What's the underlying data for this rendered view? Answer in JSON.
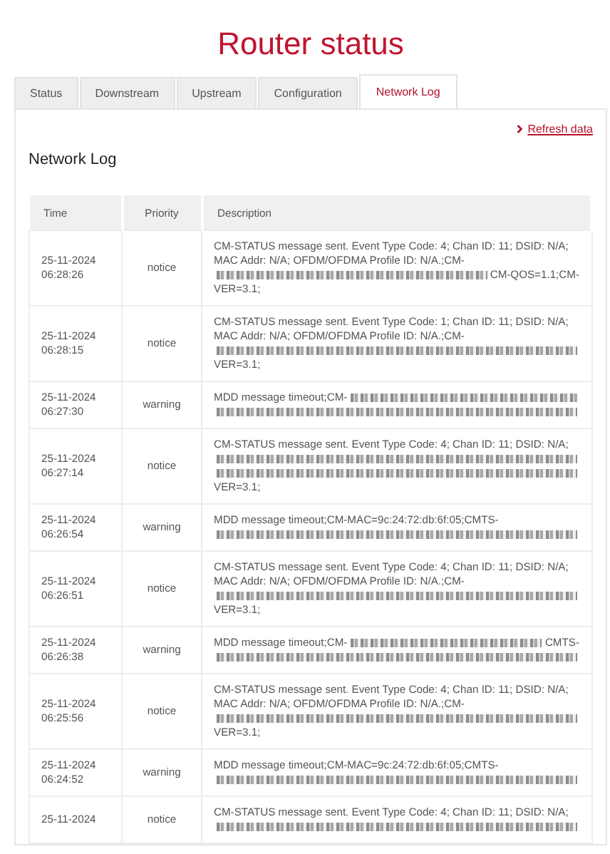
{
  "title": "Router status",
  "tabs": [
    {
      "label": "Status",
      "selected": false
    },
    {
      "label": "Downstream",
      "selected": false
    },
    {
      "label": "Upstream",
      "selected": false
    },
    {
      "label": "Configuration",
      "selected": false
    },
    {
      "label": "Network Log",
      "selected": true
    }
  ],
  "refresh_link": "Refresh data",
  "section_title": "Network Log",
  "table": {
    "columns": [
      "Time",
      "Priority",
      "Description"
    ],
    "rows": [
      {
        "time": "25-11-2024 06:28:26",
        "priority": "notice",
        "description": [
          [
            {
              "kind": "text",
              "text": "CM-STATUS message sent. Event Type Code: 4; Chan ID: 11; DSID: N/A;"
            }
          ],
          [
            {
              "kind": "text",
              "text": "MAC Addr: N/A; OFDM/OFDMA Profile ID: N/A.;CM-"
            }
          ],
          [
            {
              "kind": "redacted"
            },
            {
              "kind": "text",
              "text": "CM-QOS=1.1;CM-"
            }
          ],
          [
            {
              "kind": "text",
              "text": "VER=3.1;"
            }
          ]
        ]
      },
      {
        "time": "25-11-2024 06:28:15",
        "priority": "notice",
        "description": [
          [
            {
              "kind": "text",
              "text": "CM-STATUS message sent. Event Type Code: 1; Chan ID: 11; DSID: N/A;"
            }
          ],
          [
            {
              "kind": "text",
              "text": "MAC Addr: N/A; OFDM/OFDMA Profile ID: N/A.;CM-"
            }
          ],
          [
            {
              "kind": "redacted"
            }
          ],
          [
            {
              "kind": "text",
              "text": "VER=3.1;"
            }
          ]
        ]
      },
      {
        "time": "25-11-2024 06:27:30",
        "priority": "warning",
        "description": [
          [
            {
              "kind": "text",
              "text": "MDD message timeout;CM-"
            },
            {
              "kind": "redacted"
            }
          ],
          [
            {
              "kind": "redacted"
            }
          ]
        ]
      },
      {
        "time": "25-11-2024 06:27:14",
        "priority": "notice",
        "description": [
          [
            {
              "kind": "text",
              "text": "CM-STATUS message sent. Event Type Code: 4; Chan ID: 11; DSID: N/A;"
            }
          ],
          [
            {
              "kind": "redacted"
            }
          ],
          [
            {
              "kind": "redacted"
            }
          ],
          [
            {
              "kind": "text",
              "text": "VER=3.1;"
            }
          ]
        ]
      },
      {
        "time": "25-11-2024 06:26:54",
        "priority": "warning",
        "description": [
          [
            {
              "kind": "text",
              "text": "MDD message timeout;CM-MAC=9c:24:72:db:6f:05;CMTS-"
            }
          ],
          [
            {
              "kind": "redacted"
            }
          ]
        ]
      },
      {
        "time": "25-11-2024 06:26:51",
        "priority": "notice",
        "description": [
          [
            {
              "kind": "text",
              "text": "CM-STATUS message sent. Event Type Code: 4; Chan ID: 11; DSID: N/A;"
            }
          ],
          [
            {
              "kind": "text",
              "text": "MAC Addr: N/A; OFDM/OFDMA Profile ID: N/A.;CM-"
            }
          ],
          [
            {
              "kind": "redacted"
            }
          ],
          [
            {
              "kind": "text",
              "text": "VER=3.1;"
            }
          ]
        ]
      },
      {
        "time": "25-11-2024 06:26:38",
        "priority": "warning",
        "description": [
          [
            {
              "kind": "text",
              "text": "MDD message timeout;CM-"
            },
            {
              "kind": "redacted"
            },
            {
              "kind": "text",
              "text": "CMTS-"
            }
          ],
          [
            {
              "kind": "redacted"
            }
          ]
        ]
      },
      {
        "time": "25-11-2024 06:25:56",
        "priority": "notice",
        "description": [
          [
            {
              "kind": "text",
              "text": "CM-STATUS message sent. Event Type Code: 4; Chan ID: 11; DSID: N/A;"
            }
          ],
          [
            {
              "kind": "text",
              "text": "MAC Addr: N/A; OFDM/OFDMA Profile ID: N/A.;CM-"
            }
          ],
          [
            {
              "kind": "redacted"
            }
          ],
          [
            {
              "kind": "text",
              "text": "VER=3.1;"
            }
          ]
        ]
      },
      {
        "time": "25-11-2024 06:24:52",
        "priority": "warning",
        "description": [
          [
            {
              "kind": "text",
              "text": "MDD message timeout;CM-MAC=9c:24:72:db:6f:05;CMTS-"
            }
          ],
          [
            {
              "kind": "redacted"
            }
          ]
        ]
      },
      {
        "time": "25-11-2024",
        "priority": "notice",
        "description": [
          [
            {
              "kind": "text",
              "text": "CM-STATUS message sent. Event Type Code: 4; Chan ID: 11; DSID: N/A;"
            }
          ],
          [
            {
              "kind": "redacted"
            }
          ]
        ]
      }
    ]
  }
}
